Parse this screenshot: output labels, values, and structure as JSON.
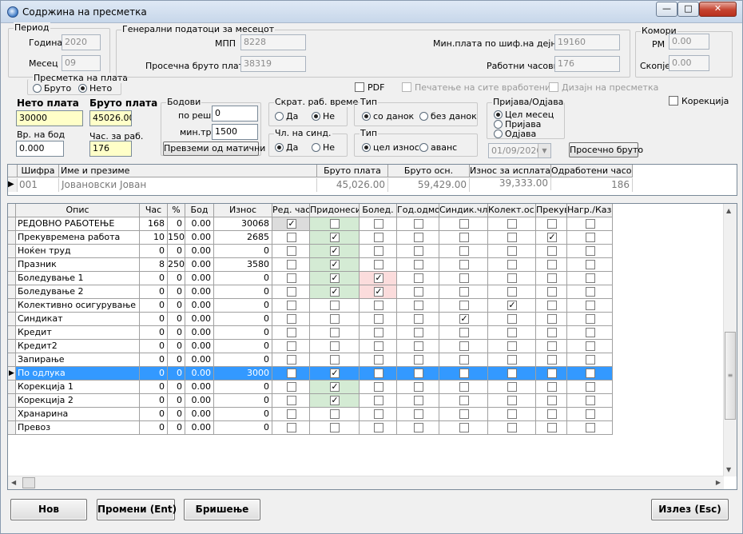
{
  "window": {
    "title": "Содржина на пресметка"
  },
  "period": {
    "title": "Период",
    "year_label": "Година",
    "year": "2020",
    "month_label": "Месец",
    "month": "09"
  },
  "general": {
    "title": "Генерални податоци за месецот",
    "mpp_label": "МПП",
    "mpp": "8228",
    "avg_label": "Просечна бруто плата",
    "avg": "38319",
    "min_label": "Мин.плата по шиф.на дејност",
    "min": "19160",
    "hours_label": "Работни часови",
    "hours": "176"
  },
  "chambers": {
    "title": "Комори",
    "rm_label": "РМ",
    "rm": "0.00",
    "sk_label": "Скопје",
    "sk": "0.00"
  },
  "calc": {
    "title": "Пресметка на плата",
    "bruto": "Бруто",
    "neto": "Нето",
    "selected": "Нето"
  },
  "checks": {
    "pdf": "PDF",
    "print_all": "Печатење на сите вработени",
    "design": "Дизајн на пресметка",
    "correction": "Корекција"
  },
  "neto_label": "Нето плата",
  "neto": "30000",
  "bruto_label": "Бруто плата",
  "bruto": "45026.00",
  "vr_bod_label": "Вр. на бод",
  "vr_bod": "0.000",
  "hours_work_label": "Час. за раб.",
  "hours_work": "176",
  "points": {
    "title": "Бодови",
    "decision_label": "по реш.",
    "decision": "0",
    "min_label": "мин.тр.",
    "min": "1500",
    "button": "Превземи од матични"
  },
  "shortened": {
    "title": "Скрат. раб. време",
    "yes": "Да",
    "no": "Не",
    "selected": "Не"
  },
  "membership": {
    "title": "Чл. на синд.",
    "yes": "Да",
    "no": "Не",
    "selected": "Да"
  },
  "type1": {
    "title": "Тип",
    "a": "со данок",
    "b": "без данок",
    "selected": "со данок"
  },
  "type2": {
    "title": "Тип",
    "a": "цел износ",
    "b": "аванс",
    "selected": "цел износ"
  },
  "reg": {
    "title": "Пријава/Одјава",
    "a": "Цел месец",
    "b": "Пријава",
    "c": "Одјава",
    "selected": "Цел месец",
    "date": "01/09/2020",
    "button": "Просечно бруто"
  },
  "employees": {
    "headers": [
      "Шифра",
      "Име и презиме",
      "Бруто плата",
      "Бруто осн.",
      "Износ за исплата",
      "Одработени часови"
    ],
    "rows": [
      {
        "code": "001",
        "name": "Јовановски Јован",
        "bruto": "45,026.00",
        "base": "59,429.00",
        "pay": "39,333.00",
        "hours": "186"
      }
    ]
  },
  "items": {
    "headers": [
      "Опис",
      "Час",
      "%",
      "Бод",
      "Износ",
      "Ред. час",
      "Придонеси",
      "Болед.",
      "Год.одмор",
      "Синдик.чл.",
      "Колект.ос.",
      "Прекувр.",
      "Нагр./Казна"
    ],
    "rows": [
      {
        "desc": "РЕДОВНО РАБОТЕЊЕ",
        "h": "168",
        "p": "0",
        "b": "0.00",
        "amt": "30068",
        "ch": [
          1,
          0,
          0,
          0,
          0,
          0,
          0,
          0
        ]
      },
      {
        "desc": "Прекувремена работа",
        "h": "10",
        "p": "150",
        "b": "0.00",
        "amt": "2685",
        "ch": [
          0,
          1,
          0,
          0,
          0,
          0,
          1,
          0
        ]
      },
      {
        "desc": "Ноќен труд",
        "h": "0",
        "p": "0",
        "b": "0.00",
        "amt": "0",
        "ch": [
          0,
          1,
          0,
          0,
          0,
          0,
          0,
          0
        ]
      },
      {
        "desc": "Празник",
        "h": "8",
        "p": "250",
        "b": "0.00",
        "amt": "3580",
        "ch": [
          0,
          1,
          0,
          0,
          0,
          0,
          0,
          0
        ]
      },
      {
        "desc": "Боледување 1",
        "h": "0",
        "p": "0",
        "b": "0.00",
        "amt": "0",
        "ch": [
          0,
          1,
          1,
          0,
          0,
          0,
          0,
          0
        ]
      },
      {
        "desc": "Боледување 2",
        "h": "0",
        "p": "0",
        "b": "0.00",
        "amt": "0",
        "ch": [
          0,
          1,
          1,
          0,
          0,
          0,
          0,
          0
        ]
      },
      {
        "desc": "Колективно осигурување",
        "h": "0",
        "p": "0",
        "b": "0.00",
        "amt": "0",
        "ch": [
          0,
          0,
          0,
          0,
          0,
          1,
          0,
          0
        ]
      },
      {
        "desc": "Синдикат",
        "h": "0",
        "p": "0",
        "b": "0.00",
        "amt": "0",
        "ch": [
          0,
          0,
          0,
          0,
          1,
          0,
          0,
          0
        ]
      },
      {
        "desc": "Кредит",
        "h": "0",
        "p": "0",
        "b": "0.00",
        "amt": "0",
        "ch": [
          0,
          0,
          0,
          0,
          0,
          0,
          0,
          0
        ]
      },
      {
        "desc": "Кредит2",
        "h": "0",
        "p": "0",
        "b": "0.00",
        "amt": "0",
        "ch": [
          0,
          0,
          0,
          0,
          0,
          0,
          0,
          0
        ]
      },
      {
        "desc": "Запирање",
        "h": "0",
        "p": "0",
        "b": "0.00",
        "amt": "0",
        "ch": [
          0,
          0,
          0,
          0,
          0,
          0,
          0,
          0
        ]
      },
      {
        "desc": "По одлука",
        "h": "0",
        "p": "0",
        "b": "0.00",
        "amt": "3000",
        "ch": [
          0,
          1,
          0,
          0,
          0,
          0,
          0,
          0
        ]
      },
      {
        "desc": "Корекција 1",
        "h": "0",
        "p": "0",
        "b": "0.00",
        "amt": "0",
        "ch": [
          0,
          1,
          0,
          0,
          0,
          0,
          0,
          0
        ]
      },
      {
        "desc": "Корекција 2",
        "h": "0",
        "p": "0",
        "b": "0.00",
        "amt": "0",
        "ch": [
          0,
          1,
          0,
          0,
          0,
          0,
          0,
          0
        ]
      },
      {
        "desc": "Хранарина",
        "h": "0",
        "p": "0",
        "b": "0.00",
        "amt": "0",
        "ch": [
          0,
          0,
          0,
          0,
          0,
          0,
          0,
          0
        ]
      },
      {
        "desc": "Превоз",
        "h": "0",
        "p": "0",
        "b": "0.00",
        "amt": "0",
        "ch": [
          0,
          0,
          0,
          0,
          0,
          0,
          0,
          0
        ]
      }
    ]
  },
  "buttons": {
    "new": "Нов",
    "edit": "Промени (Ent)",
    "delete": "Бришење",
    "exit": "Излез (Esc)"
  },
  "colors": {
    "selection": "#3399ff",
    "green": "#d4ebd4",
    "pink": "#fbdcdc",
    "yellow": "#ffffc8"
  }
}
